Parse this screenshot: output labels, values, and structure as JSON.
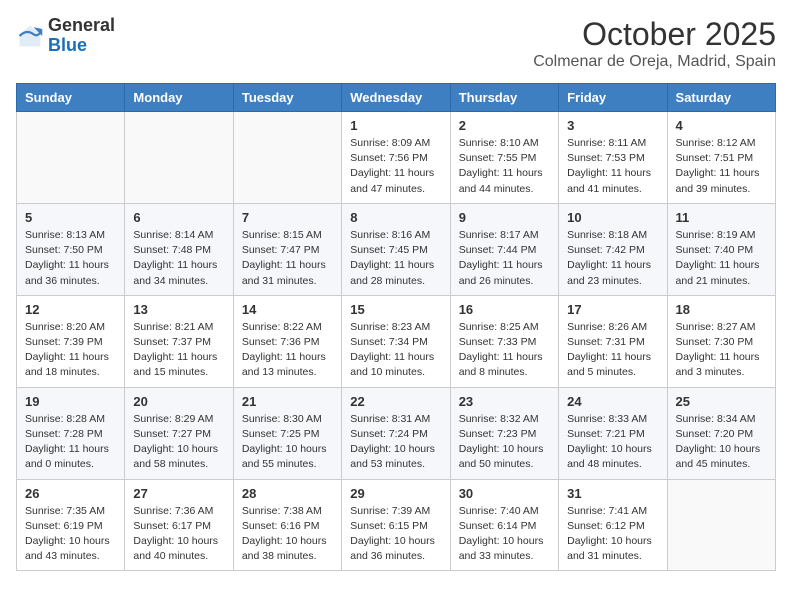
{
  "header": {
    "logo_general": "General",
    "logo_blue": "Blue",
    "month_title": "October 2025",
    "location": "Colmenar de Oreja, Madrid, Spain"
  },
  "weekdays": [
    "Sunday",
    "Monday",
    "Tuesday",
    "Wednesday",
    "Thursday",
    "Friday",
    "Saturday"
  ],
  "weeks": [
    [
      {
        "day": "",
        "info": ""
      },
      {
        "day": "",
        "info": ""
      },
      {
        "day": "",
        "info": ""
      },
      {
        "day": "1",
        "info": "Sunrise: 8:09 AM\nSunset: 7:56 PM\nDaylight: 11 hours\nand 47 minutes."
      },
      {
        "day": "2",
        "info": "Sunrise: 8:10 AM\nSunset: 7:55 PM\nDaylight: 11 hours\nand 44 minutes."
      },
      {
        "day": "3",
        "info": "Sunrise: 8:11 AM\nSunset: 7:53 PM\nDaylight: 11 hours\nand 41 minutes."
      },
      {
        "day": "4",
        "info": "Sunrise: 8:12 AM\nSunset: 7:51 PM\nDaylight: 11 hours\nand 39 minutes."
      }
    ],
    [
      {
        "day": "5",
        "info": "Sunrise: 8:13 AM\nSunset: 7:50 PM\nDaylight: 11 hours\nand 36 minutes."
      },
      {
        "day": "6",
        "info": "Sunrise: 8:14 AM\nSunset: 7:48 PM\nDaylight: 11 hours\nand 34 minutes."
      },
      {
        "day": "7",
        "info": "Sunrise: 8:15 AM\nSunset: 7:47 PM\nDaylight: 11 hours\nand 31 minutes."
      },
      {
        "day": "8",
        "info": "Sunrise: 8:16 AM\nSunset: 7:45 PM\nDaylight: 11 hours\nand 28 minutes."
      },
      {
        "day": "9",
        "info": "Sunrise: 8:17 AM\nSunset: 7:44 PM\nDaylight: 11 hours\nand 26 minutes."
      },
      {
        "day": "10",
        "info": "Sunrise: 8:18 AM\nSunset: 7:42 PM\nDaylight: 11 hours\nand 23 minutes."
      },
      {
        "day": "11",
        "info": "Sunrise: 8:19 AM\nSunset: 7:40 PM\nDaylight: 11 hours\nand 21 minutes."
      }
    ],
    [
      {
        "day": "12",
        "info": "Sunrise: 8:20 AM\nSunset: 7:39 PM\nDaylight: 11 hours\nand 18 minutes."
      },
      {
        "day": "13",
        "info": "Sunrise: 8:21 AM\nSunset: 7:37 PM\nDaylight: 11 hours\nand 15 minutes."
      },
      {
        "day": "14",
        "info": "Sunrise: 8:22 AM\nSunset: 7:36 PM\nDaylight: 11 hours\nand 13 minutes."
      },
      {
        "day": "15",
        "info": "Sunrise: 8:23 AM\nSunset: 7:34 PM\nDaylight: 11 hours\nand 10 minutes."
      },
      {
        "day": "16",
        "info": "Sunrise: 8:25 AM\nSunset: 7:33 PM\nDaylight: 11 hours\nand 8 minutes."
      },
      {
        "day": "17",
        "info": "Sunrise: 8:26 AM\nSunset: 7:31 PM\nDaylight: 11 hours\nand 5 minutes."
      },
      {
        "day": "18",
        "info": "Sunrise: 8:27 AM\nSunset: 7:30 PM\nDaylight: 11 hours\nand 3 minutes."
      }
    ],
    [
      {
        "day": "19",
        "info": "Sunrise: 8:28 AM\nSunset: 7:28 PM\nDaylight: 11 hours\nand 0 minutes."
      },
      {
        "day": "20",
        "info": "Sunrise: 8:29 AM\nSunset: 7:27 PM\nDaylight: 10 hours\nand 58 minutes."
      },
      {
        "day": "21",
        "info": "Sunrise: 8:30 AM\nSunset: 7:25 PM\nDaylight: 10 hours\nand 55 minutes."
      },
      {
        "day": "22",
        "info": "Sunrise: 8:31 AM\nSunset: 7:24 PM\nDaylight: 10 hours\nand 53 minutes."
      },
      {
        "day": "23",
        "info": "Sunrise: 8:32 AM\nSunset: 7:23 PM\nDaylight: 10 hours\nand 50 minutes."
      },
      {
        "day": "24",
        "info": "Sunrise: 8:33 AM\nSunset: 7:21 PM\nDaylight: 10 hours\nand 48 minutes."
      },
      {
        "day": "25",
        "info": "Sunrise: 8:34 AM\nSunset: 7:20 PM\nDaylight: 10 hours\nand 45 minutes."
      }
    ],
    [
      {
        "day": "26",
        "info": "Sunrise: 7:35 AM\nSunset: 6:19 PM\nDaylight: 10 hours\nand 43 minutes."
      },
      {
        "day": "27",
        "info": "Sunrise: 7:36 AM\nSunset: 6:17 PM\nDaylight: 10 hours\nand 40 minutes."
      },
      {
        "day": "28",
        "info": "Sunrise: 7:38 AM\nSunset: 6:16 PM\nDaylight: 10 hours\nand 38 minutes."
      },
      {
        "day": "29",
        "info": "Sunrise: 7:39 AM\nSunset: 6:15 PM\nDaylight: 10 hours\nand 36 minutes."
      },
      {
        "day": "30",
        "info": "Sunrise: 7:40 AM\nSunset: 6:14 PM\nDaylight: 10 hours\nand 33 minutes."
      },
      {
        "day": "31",
        "info": "Sunrise: 7:41 AM\nSunset: 6:12 PM\nDaylight: 10 hours\nand 31 minutes."
      },
      {
        "day": "",
        "info": ""
      }
    ]
  ]
}
